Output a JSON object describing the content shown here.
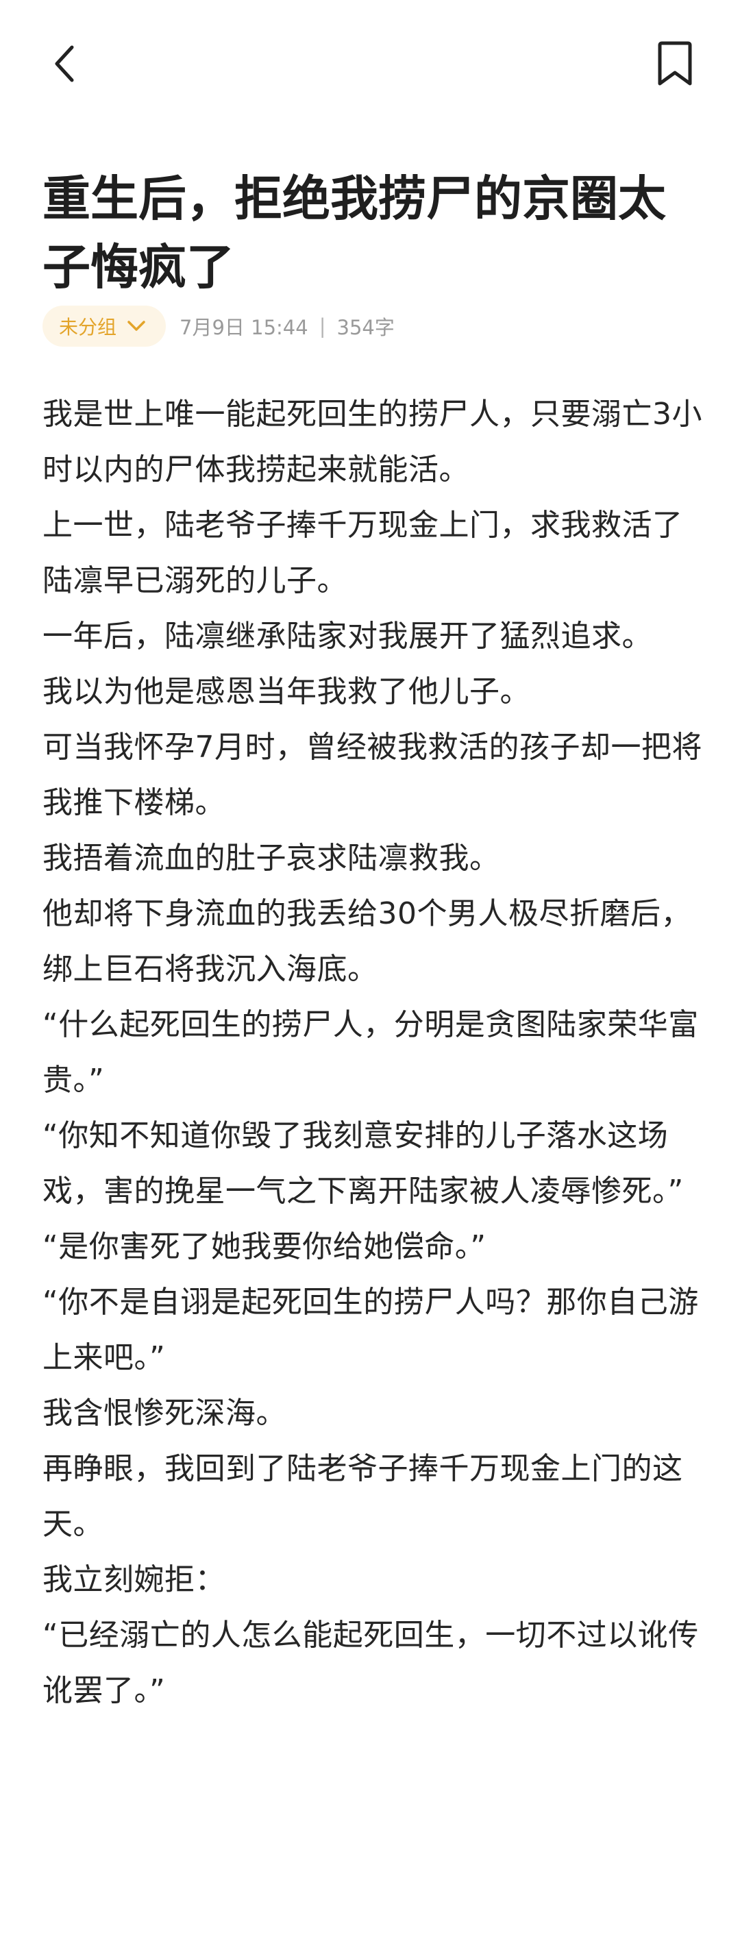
{
  "header": {
    "back_icon": "chevron-left-icon",
    "bookmark_icon": "bookmark-icon"
  },
  "article": {
    "title": "重生后，拒绝我捞尸的京圈太子悔疯了",
    "group_label": "未分组",
    "date": "7月9日 15:44",
    "separator": "|",
    "word_count": "354字",
    "paragraphs": [
      "我是世上唯一能起死回生的捞尸人，只要溺亡3小时以内的尸体我捞起来就能活。",
      "上一世，陆老爷子捧千万现金上门，求我救活了陆凛早已溺死的儿子。",
      "一年后，陆凛继承陆家对我展开了猛烈追求。",
      "我以为他是感恩当年我救了他儿子。",
      "可当我怀孕7月时，曾经被我救活的孩子却一把将我推下楼梯。",
      "我捂着流血的肚子哀求陆凛救我。",
      "他却将下身流血的我丢给30个男人极尽折磨后，绑上巨石将我沉入海底。",
      "“什么起死回生的捞尸人，分明是贪图陆家荣华富贵。”",
      "“你知不知道你毁了我刻意安排的儿子落水这场戏，害的挽星一气之下离开陆家被人凌辱惨死。”",
      "“是你害死了她我要你给她偿命。”",
      "“你不是自诩是起死回生的捞尸人吗？那你自己游上来吧。”",
      "我含恨惨死深海。",
      "再睁眼，我回到了陆老爷子捧千万现金上门的这天。",
      "我立刻婉拒：",
      "“已经溺亡的人怎么能起死回生，一切不过以讹传讹罢了。”"
    ]
  },
  "colors": {
    "accent": "#e3a42a",
    "chip_bg": "#fdf5e6",
    "meta": "#9a9a9a",
    "text": "#262626"
  }
}
